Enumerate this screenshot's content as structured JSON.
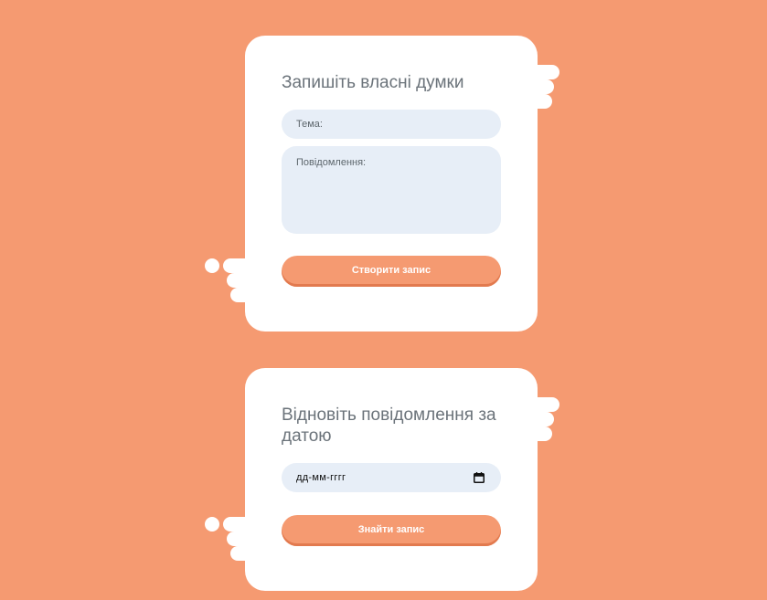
{
  "write_form": {
    "title": "Запишіть власні думки",
    "topic_placeholder": "Тема:",
    "message_placeholder": "Повідомлення:",
    "submit_label": "Створити запис"
  },
  "restore_form": {
    "title": "Відновіть повідомлення за датою",
    "date_placeholder": "дд-мм-гггг",
    "submit_label": "Знайти запис"
  },
  "colors": {
    "background": "#f59a71",
    "card": "#ffffff",
    "field": "#e7eef7",
    "button": "#f59a71",
    "title_text": "#6b737a"
  },
  "icons": {
    "date_picker": "calendar-icon"
  }
}
